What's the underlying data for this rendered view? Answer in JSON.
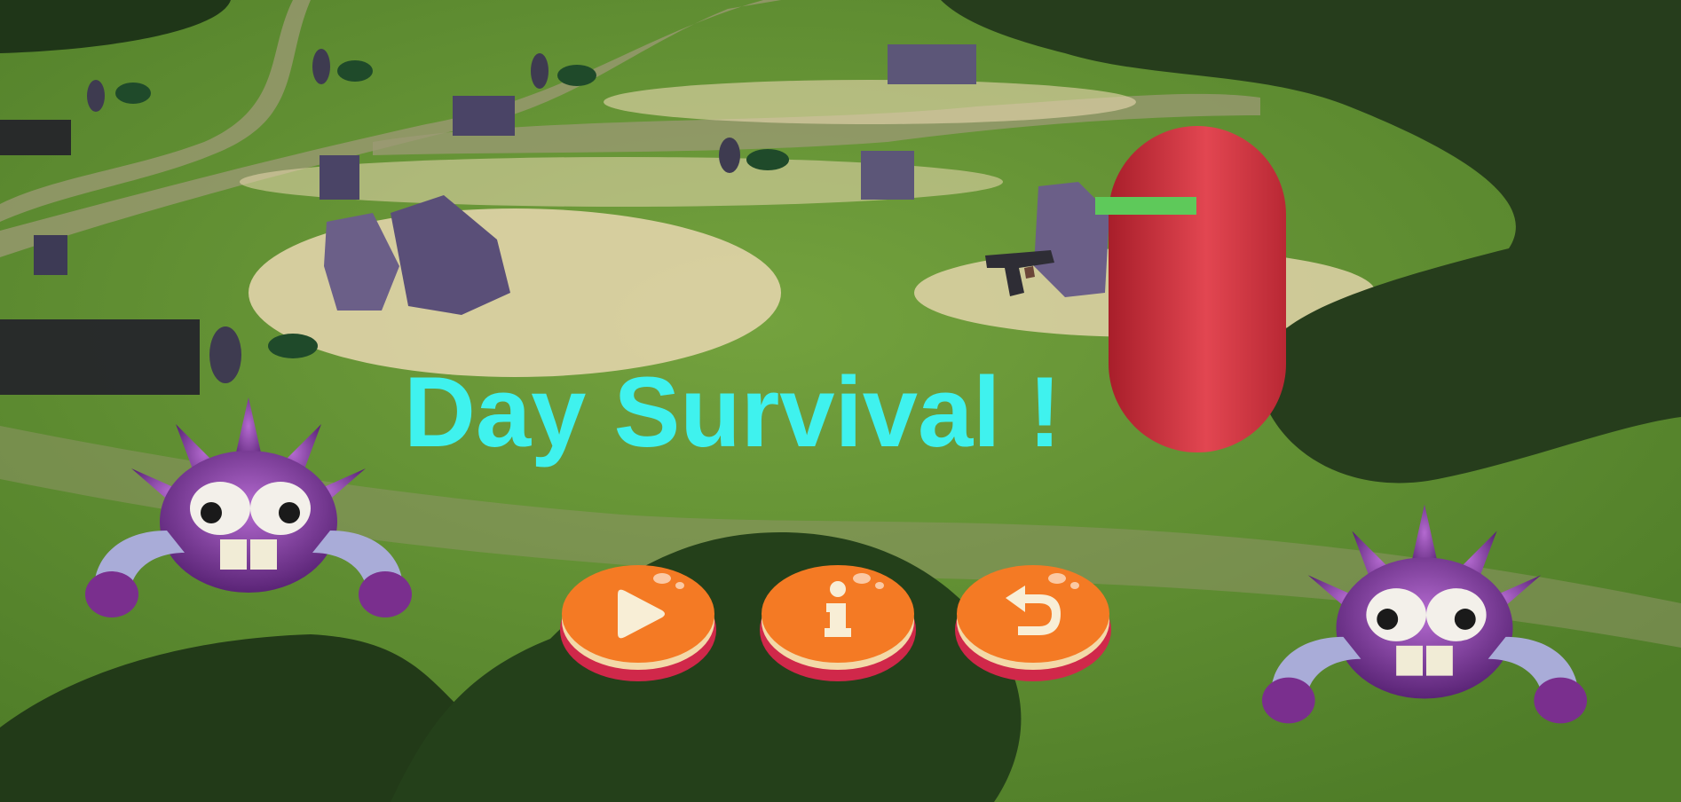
{
  "game": {
    "title": "Day Survival !",
    "title_color": "#3ff2ee",
    "menu_buttons": [
      {
        "action": "play",
        "icon": "play-icon"
      },
      {
        "action": "info",
        "icon": "info-icon"
      },
      {
        "action": "back",
        "icon": "undo-arrow-icon"
      }
    ],
    "player": {
      "shape": "red capsule",
      "color": "#d23a45",
      "health_fraction": 1.0,
      "health_color": "#5ec95a"
    },
    "enemies": [
      {
        "type": "purple spiky monster",
        "icon": "monster-icon"
      },
      {
        "type": "purple spiky monster",
        "icon": "monster-icon"
      }
    ],
    "weapon": {
      "type": "pistol",
      "icon": "pistol-icon"
    }
  }
}
